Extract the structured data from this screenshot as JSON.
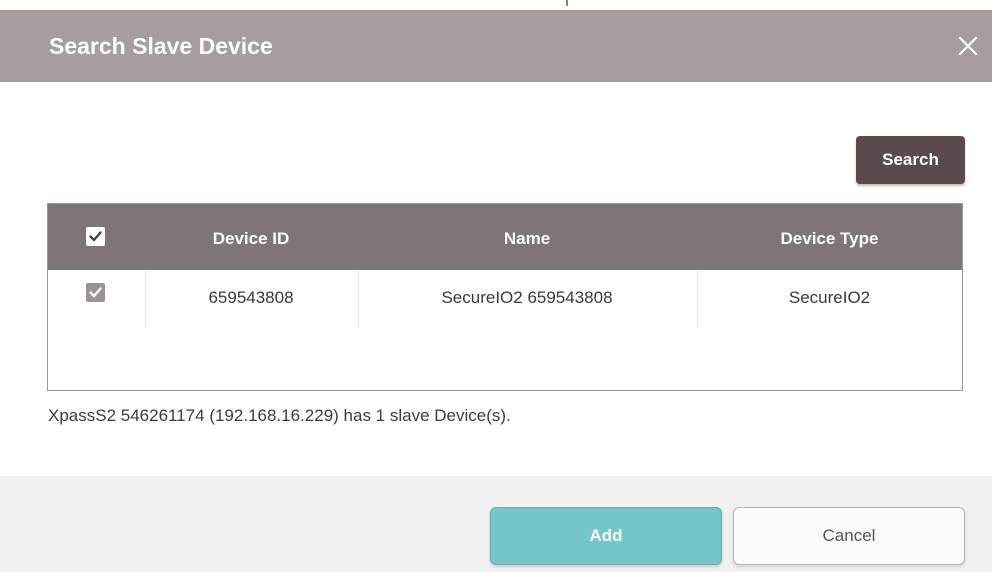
{
  "dialog": {
    "title": "Search Slave Device",
    "close_icon": "close-icon"
  },
  "toolbar": {
    "search_label": "Search"
  },
  "table": {
    "columns": [
      "Device ID",
      "Name",
      "Device Type"
    ],
    "select_all_checked": true,
    "rows": [
      {
        "checked": true,
        "device_id": "659543808",
        "name": "SecureIO2 659543808",
        "device_type": "SecureIO2"
      }
    ]
  },
  "status_text": "XpassS2 546261174 (192.168.16.229) has 1 slave Device(s).",
  "footer": {
    "add_label": "Add",
    "cancel_label": "Cancel"
  },
  "colors": {
    "header_bg": "#a89d9d",
    "table_header_bg": "#7f7575",
    "search_button_bg": "#5a4a4c",
    "add_button_bg": "#74c6c8"
  }
}
